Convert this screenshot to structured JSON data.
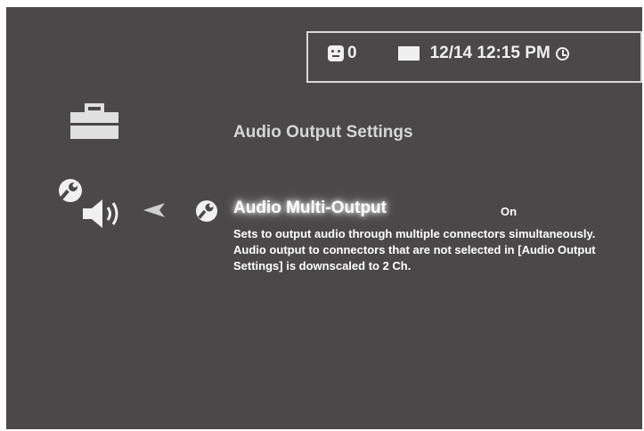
{
  "status": {
    "message_count": "0",
    "datetime": "12/14 12:15 PM"
  },
  "menu": {
    "heading": "Audio Output Settings"
  },
  "option": {
    "title": "Audio Multi-Output",
    "value": "On",
    "description": "Sets to output audio through multiple connectors simultaneously. Audio output to connectors that are not selected in [Audio Output Settings] is downscaled to 2 Ch."
  },
  "icons": [
    "toolbox-icon",
    "wrench-icon",
    "speaker-icon",
    "arrow-left-icon",
    "face-icon",
    "mail-icon",
    "clock-icon"
  ],
  "colors": {
    "background": "#4a4848",
    "text": "#ffffff",
    "heading": "#d6d6d6"
  }
}
